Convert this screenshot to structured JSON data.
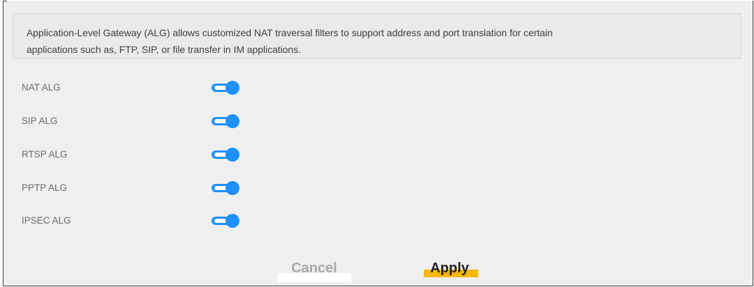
{
  "description": {
    "line1": "Application-Level Gateway (ALG) allows customized NAT traversal filters to support address and port translation for certain",
    "line2": "applications such as, FTP, SIP, or file transfer in IM applications."
  },
  "settings": [
    {
      "label": "NAT ALG",
      "enabled": true
    },
    {
      "label": "SIP ALG",
      "enabled": true
    },
    {
      "label": "RTSP ALG",
      "enabled": true
    },
    {
      "label": "PPTP ALG",
      "enabled": true
    },
    {
      "label": "IPSEC ALG",
      "enabled": true
    }
  ],
  "buttons": {
    "cancel": "Cancel",
    "apply": "Apply"
  },
  "colors": {
    "toggle_on": "#1e90ff",
    "apply_highlight": "#f7b800"
  }
}
